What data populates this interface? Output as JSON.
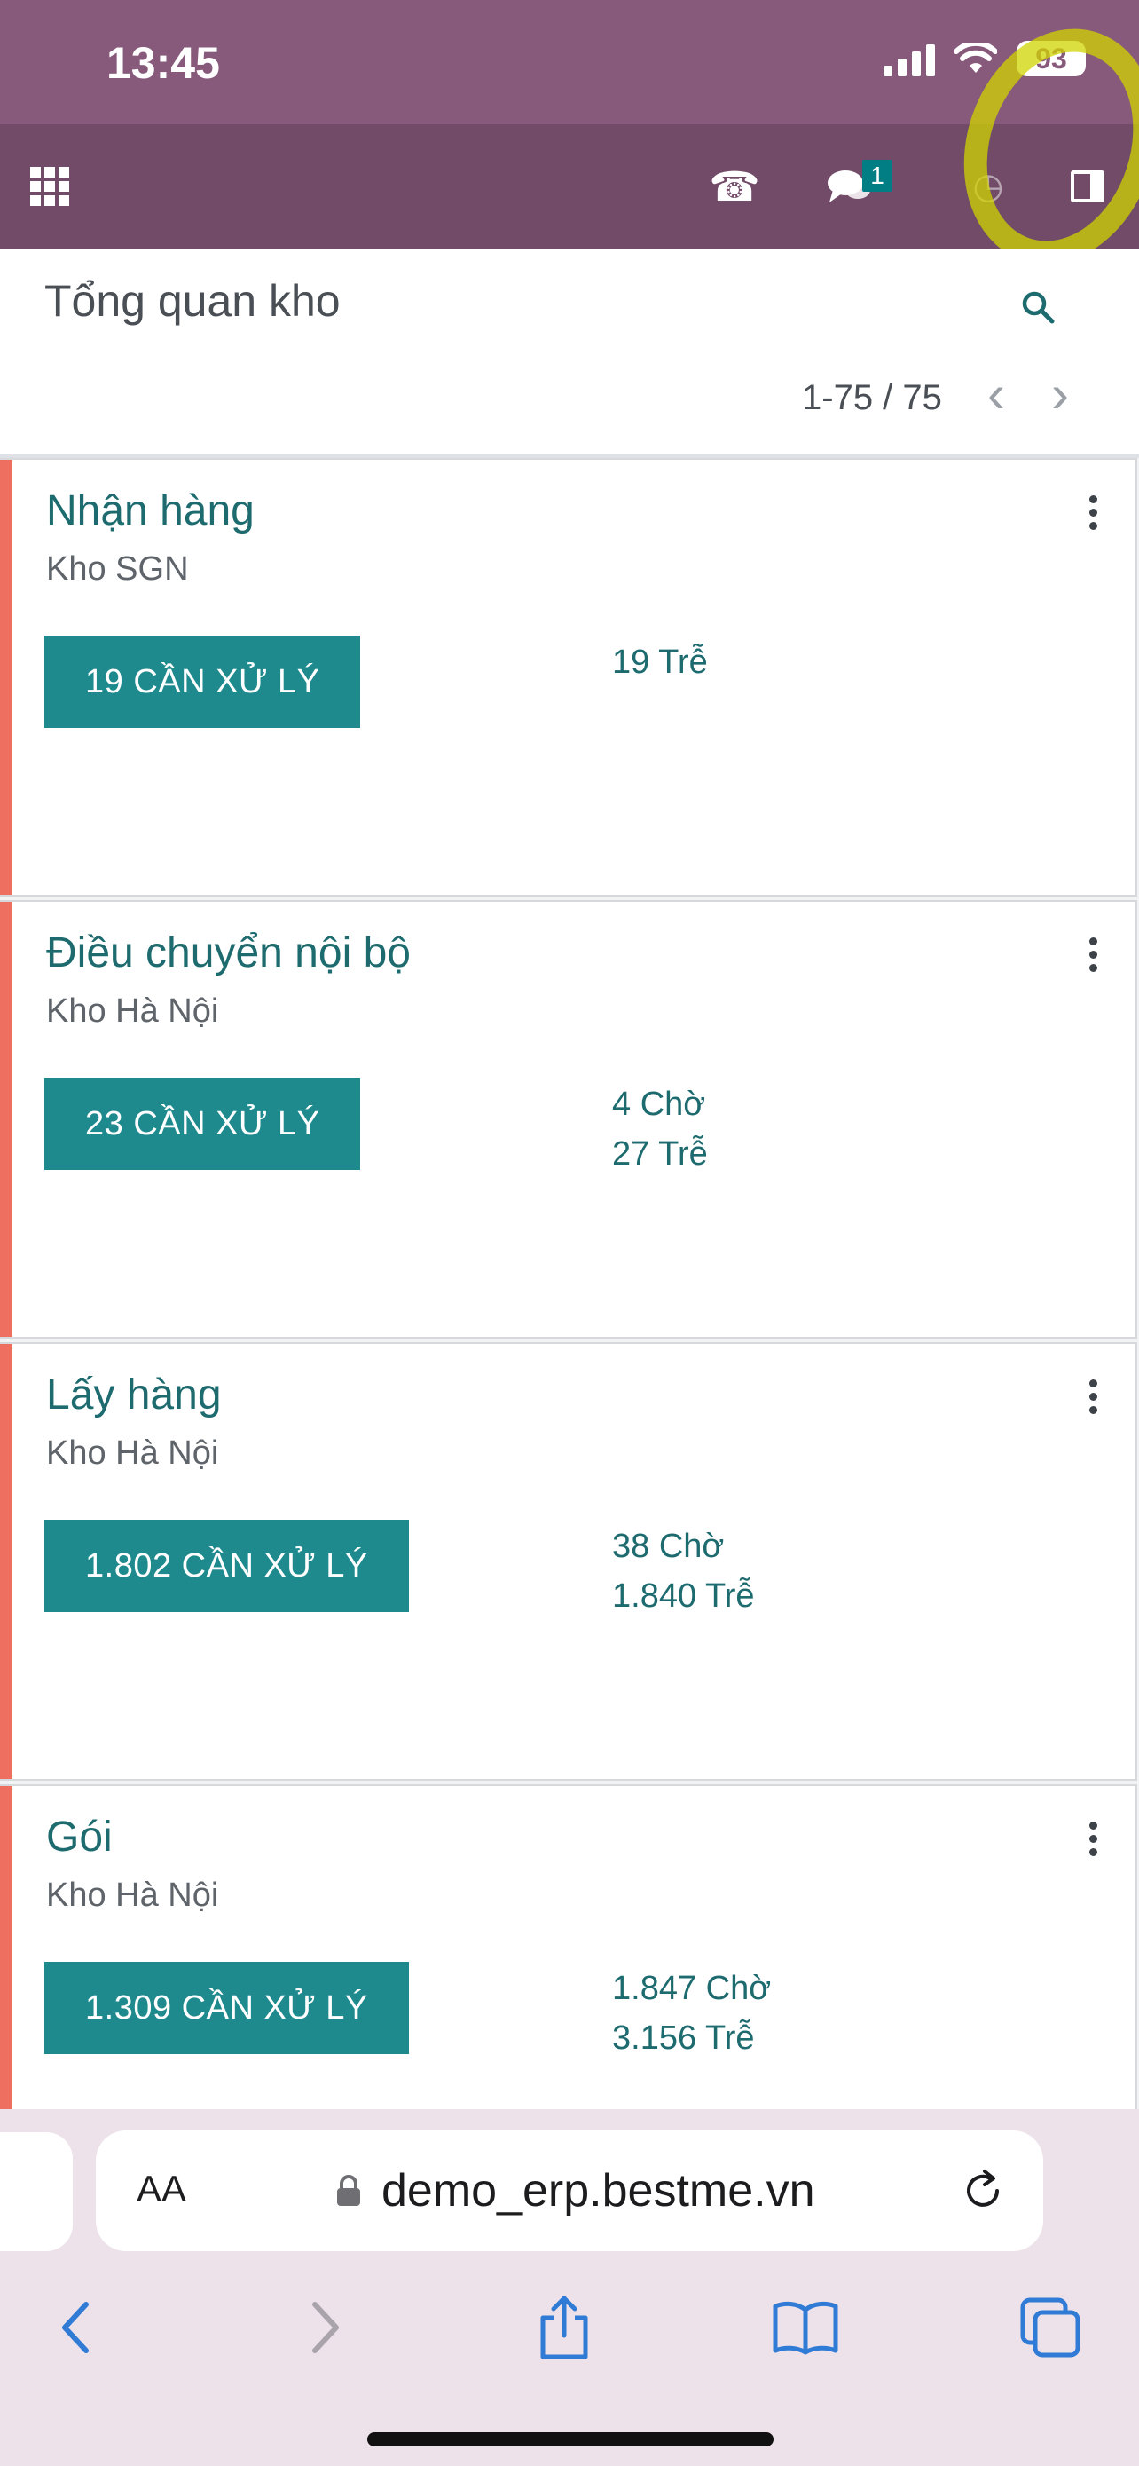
{
  "status_bar": {
    "time": "13:45",
    "battery": "93"
  },
  "navbar": {
    "chat_badge": "1"
  },
  "control_panel": {
    "title": "Tổng quan kho",
    "pager": "1-75 / 75"
  },
  "cards": [
    {
      "title": "Nhận hàng",
      "warehouse": "Kho SGN",
      "button": "19 CẦN XỬ LÝ",
      "stats": [
        "19 Trễ"
      ]
    },
    {
      "title": "Điều chuyển nội bộ",
      "warehouse": "Kho Hà Nội",
      "button": "23 CẦN XỬ LÝ",
      "stats": [
        "4 Chờ",
        "27 Trễ"
      ]
    },
    {
      "title": "Lấy hàng",
      "warehouse": "Kho Hà Nội",
      "button": "1.802 CẦN XỬ LÝ",
      "stats": [
        "38 Chờ",
        "1.840 Trễ"
      ]
    },
    {
      "title": "Gói",
      "warehouse": "Kho Hà Nội",
      "button": "1.309 CẦN XỬ LÝ",
      "stats": [
        "1.847 Chờ",
        "3.156 Trễ"
      ]
    }
  ],
  "browser": {
    "aa_label": "AA",
    "url": "demo_erp.bestme.vn"
  },
  "colors": {
    "status_bar": "#875a7b",
    "navbar": "#714b67",
    "accent": "#1e8a8e",
    "card_stripe": "#ee6e5f"
  }
}
